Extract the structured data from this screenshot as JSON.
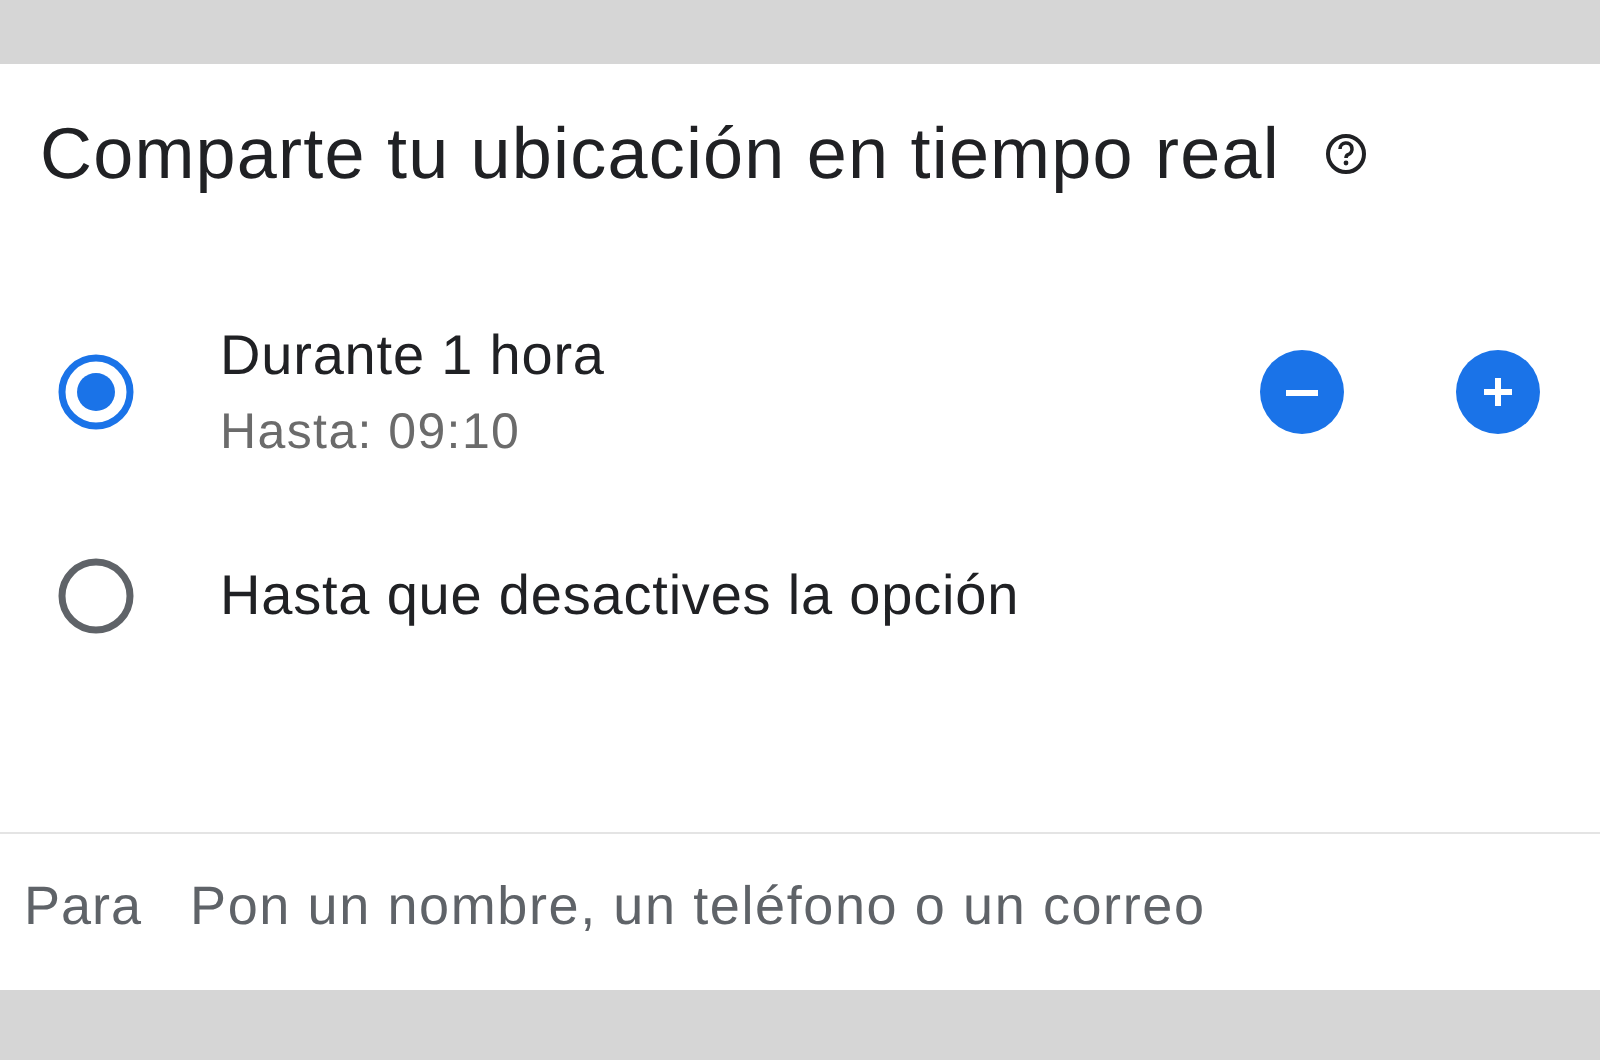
{
  "title": "Comparte tu ubicación en tiempo real",
  "options": [
    {
      "kind": "stepper",
      "label": "Durante 1 hora",
      "sublabel": "Hasta: 09:10",
      "selected": true
    },
    {
      "kind": "plain",
      "label": "Hasta que desactives la opción",
      "selected": false
    }
  ],
  "recipient": {
    "label": "Para",
    "placeholder": "Pon un nombre, un teléfono o un correo"
  }
}
